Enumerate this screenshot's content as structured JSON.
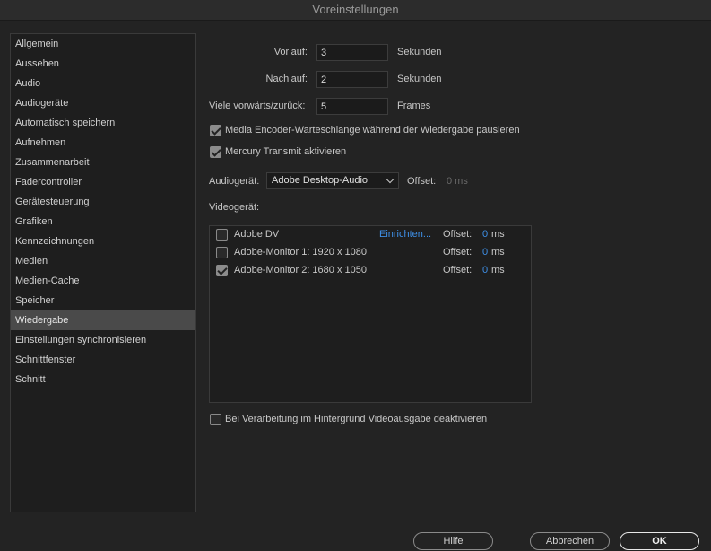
{
  "window": {
    "title": "Voreinstellungen"
  },
  "sidebar": {
    "items": [
      {
        "label": "Allgemein"
      },
      {
        "label": "Aussehen"
      },
      {
        "label": "Audio"
      },
      {
        "label": "Audiogeräte"
      },
      {
        "label": "Automatisch speichern"
      },
      {
        "label": "Aufnehmen"
      },
      {
        "label": "Zusammenarbeit"
      },
      {
        "label": "Fadercontroller"
      },
      {
        "label": "Gerätesteuerung"
      },
      {
        "label": "Grafiken"
      },
      {
        "label": "Kennzeichnungen"
      },
      {
        "label": "Medien"
      },
      {
        "label": "Medien-Cache"
      },
      {
        "label": "Speicher"
      },
      {
        "label": "Wiedergabe",
        "selected": true
      },
      {
        "label": "Einstellungen synchronisieren"
      },
      {
        "label": "Schnittfenster"
      },
      {
        "label": "Schnitt"
      }
    ]
  },
  "playback": {
    "preroll": {
      "label": "Vorlauf:",
      "value": "3",
      "unit": "Sekunden"
    },
    "postroll": {
      "label": "Nachlauf:",
      "value": "2",
      "unit": "Sekunden"
    },
    "step": {
      "label": "Viele vorwärts/zurück:",
      "value": "5",
      "unit": "Frames"
    },
    "pause_media_encoder": {
      "label": "Media Encoder-Warteschlange während der Wiedergabe pausieren",
      "checked": true
    },
    "mercury_transmit": {
      "label": "Mercury Transmit aktivieren",
      "checked": true
    },
    "audio_device": {
      "label": "Audiogerät:",
      "value": "Adobe Desktop-Audio",
      "offset_label": "Offset:",
      "offset_value": "0 ms"
    },
    "video_device": {
      "label": "Videogerät:",
      "devices": [
        {
          "name": "Adobe DV",
          "checked": false,
          "setup": "Einrichten...",
          "offset_label": "Offset:",
          "offset_value": "0",
          "offset_unit": "ms"
        },
        {
          "name": "Adobe-Monitor 1: 1920 x 1080",
          "checked": false,
          "offset_label": "Offset:",
          "offset_value": "0",
          "offset_unit": "ms"
        },
        {
          "name": "Adobe-Monitor 2: 1680 x 1050",
          "checked": true,
          "offset_label": "Offset:",
          "offset_value": "0",
          "offset_unit": "ms"
        }
      ]
    },
    "disable_background": {
      "label": "Bei Verarbeitung im Hintergrund Videoausgabe deaktivieren",
      "checked": false
    }
  },
  "footer": {
    "help": "Hilfe",
    "cancel": "Abbrechen",
    "ok": "OK"
  },
  "colors": {
    "accent": "#3e8fe6",
    "background": "#232323"
  }
}
